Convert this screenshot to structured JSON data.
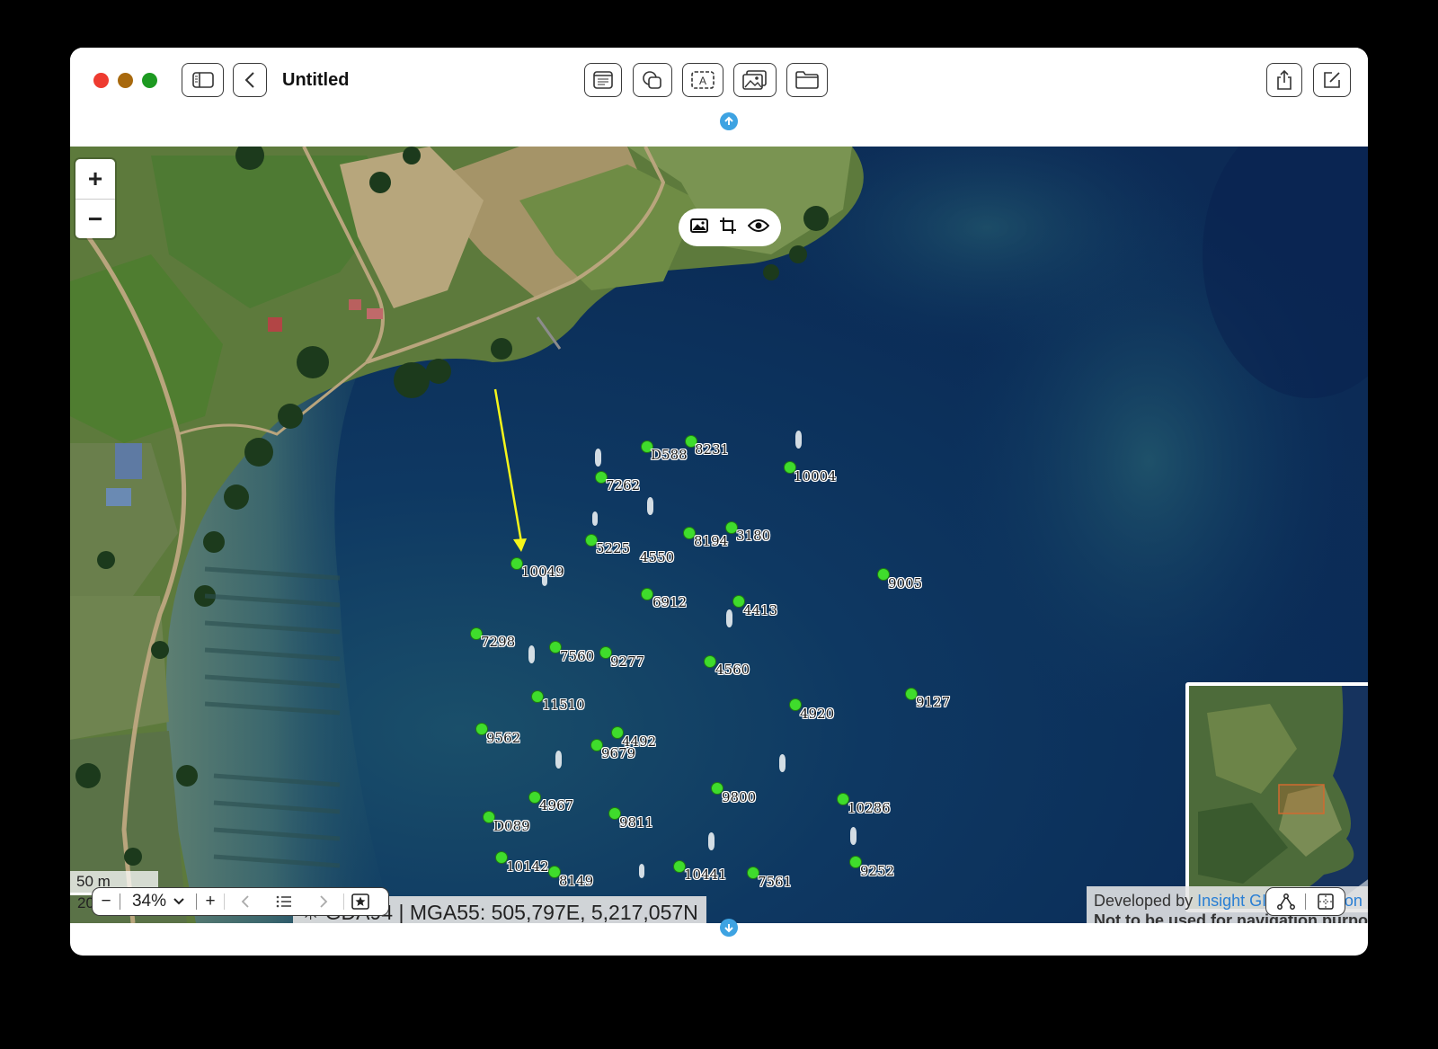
{
  "window": {
    "title": "Untitled",
    "toolbar_icons": [
      "sidebar-icon",
      "back-icon",
      "text-box-icon",
      "shapes-icon",
      "text-frame-icon",
      "media-icon",
      "folder-icon",
      "share-icon",
      "compose-icon"
    ]
  },
  "map": {
    "zoom_in_label": "+",
    "zoom_out_label": "−",
    "scale_label": "50 m",
    "scale_label_2": "20",
    "coordinates": "MGA55: 505,797E, 5,217,057N",
    "coordinates_prefix": "✳ GDA94 |",
    "attribution_prefix": "Developed by ",
    "attribution_link1": "Insight GIS",
    "attribution_sep": " | ",
    "attribution_link2": "Attribution",
    "attribution_line2": "Not to be used for navigation purposes",
    "markers": [
      {
        "label": "D588"
      },
      {
        "label": "8231"
      },
      {
        "label": "10004"
      },
      {
        "label": "7262"
      },
      {
        "label": "8194"
      },
      {
        "label": "3180"
      },
      {
        "label": "5225"
      },
      {
        "label": "4550"
      },
      {
        "label": "10049"
      },
      {
        "label": "9005"
      },
      {
        "label": "6912"
      },
      {
        "label": "4413"
      },
      {
        "label": "7298"
      },
      {
        "label": "7560"
      },
      {
        "label": "9277"
      },
      {
        "label": "4560"
      },
      {
        "label": "11510"
      },
      {
        "label": "4920"
      },
      {
        "label": "9127"
      },
      {
        "label": "9562"
      },
      {
        "label": "4492"
      },
      {
        "label": "9679"
      },
      {
        "label": "9800"
      },
      {
        "label": "4967"
      },
      {
        "label": "10286"
      },
      {
        "label": "D089"
      },
      {
        "label": "9811"
      },
      {
        "label": "10142"
      },
      {
        "label": "8149"
      },
      {
        "label": "10441"
      },
      {
        "label": "7561"
      },
      {
        "label": "9252"
      }
    ]
  },
  "bottom": {
    "zoom_level": "34%",
    "minus_label": "−",
    "plus_label": "+"
  },
  "colors": {
    "marker": "#3fdc2c",
    "arrow": "#f5f51a",
    "traffic_red": "#ee3b30",
    "traffic_yellow": "#a8690e",
    "traffic_green": "#1d9a21",
    "handle": "#3ea3e2"
  }
}
